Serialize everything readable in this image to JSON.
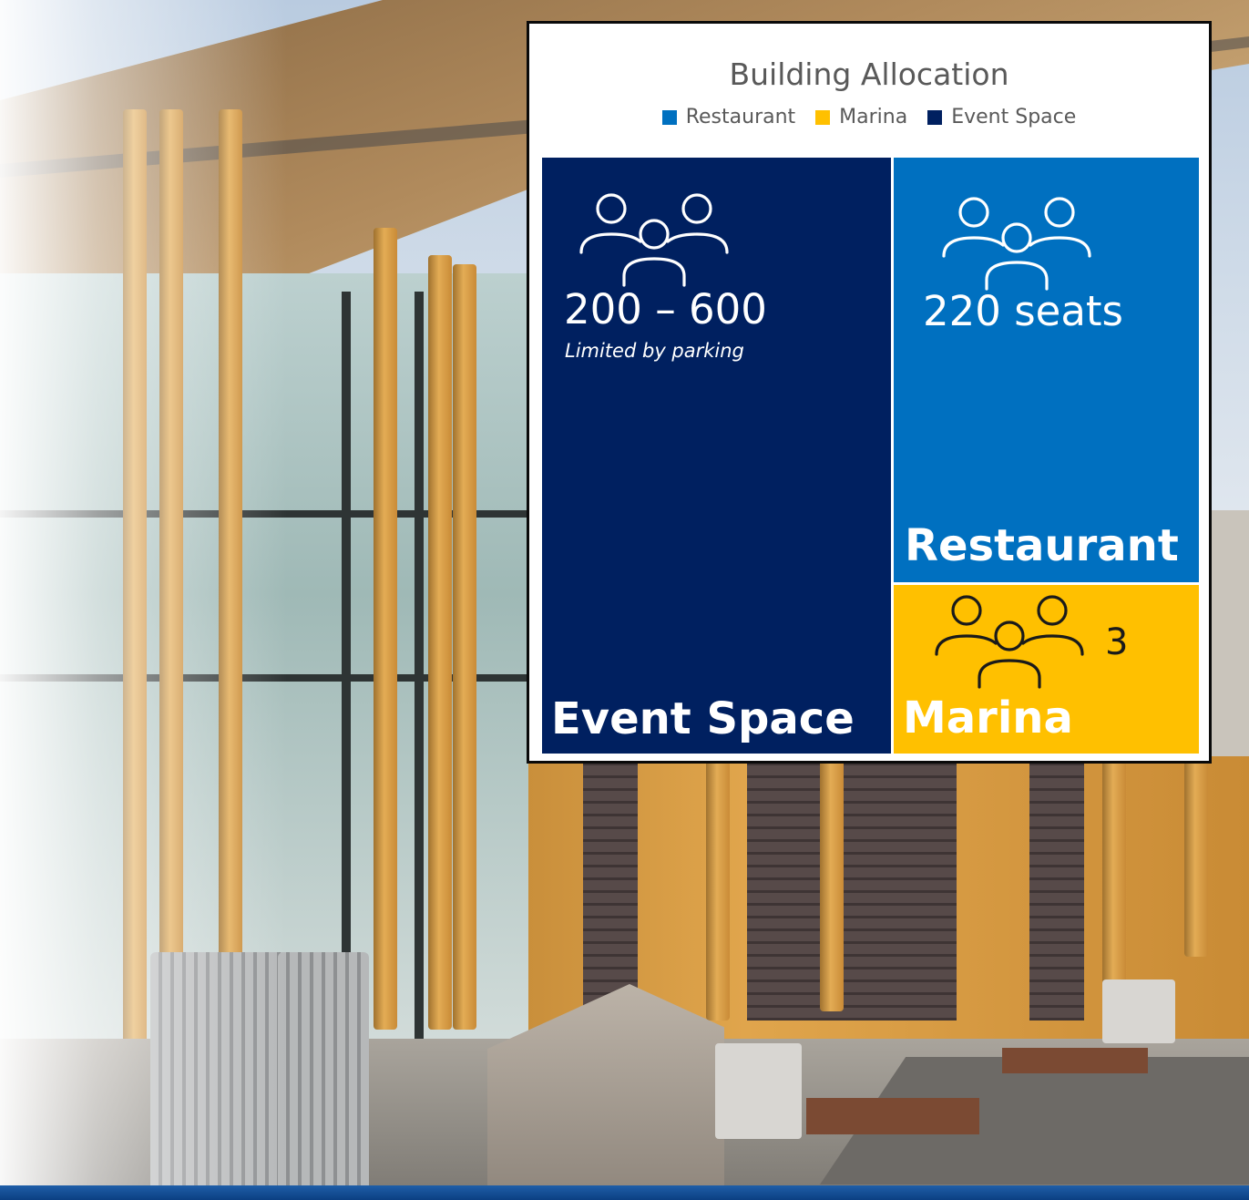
{
  "chart_data": {
    "type": "treemap",
    "title": "Building Allocation",
    "legend": [
      {
        "name": "Restaurant",
        "color": "#0070c0"
      },
      {
        "name": "Marina",
        "color": "#ffc000"
      },
      {
        "name": "Event Space",
        "color": "#002060"
      }
    ],
    "legend_position": "top",
    "tiles": [
      {
        "name": "Event Space",
        "color": "#002060",
        "capacity": "200 – 600",
        "note": "Limited by parking",
        "icon": "people-icon"
      },
      {
        "name": "Restaurant",
        "color": "#0070c0",
        "capacity": "220 seats",
        "icon": "people-icon"
      },
      {
        "name": "Marina",
        "color": "#ffc000",
        "capacity": "3",
        "icon": "people-icon"
      }
    ]
  }
}
